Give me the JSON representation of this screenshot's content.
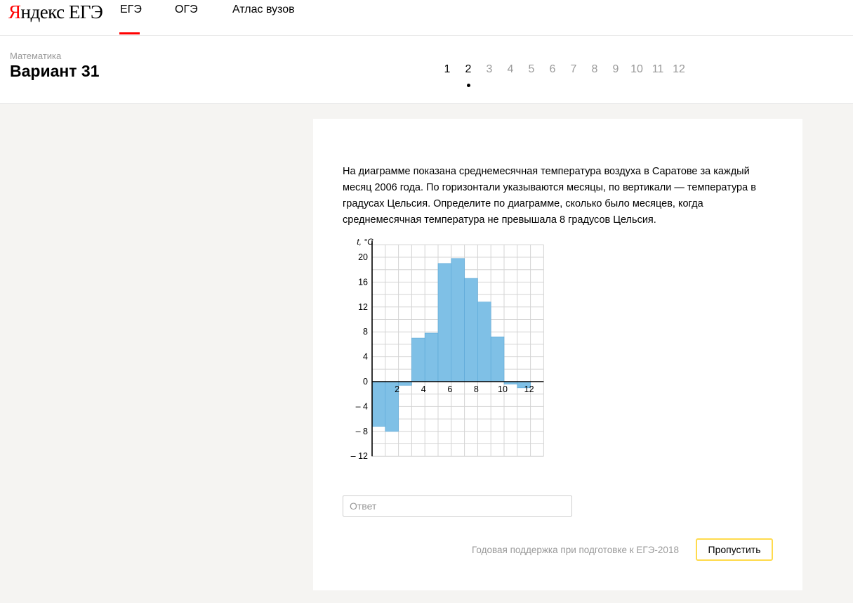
{
  "logo": {
    "part1": "Я",
    "part2": "ндекс ЕГЭ"
  },
  "nav": [
    {
      "label": "ЕГЭ",
      "active": true
    },
    {
      "label": "ОГЭ",
      "active": false
    },
    {
      "label": "Атлас вузов",
      "active": false
    }
  ],
  "header": {
    "subject": "Математика",
    "variant": "Вариант 31"
  },
  "pager": {
    "pages": [
      "1",
      "2",
      "3",
      "4",
      "5",
      "6",
      "7",
      "8",
      "9",
      "10",
      "11",
      "12"
    ],
    "current": "2"
  },
  "question": {
    "text": "На диаграмме показана среднемесячная температура воздуха в Саратове за каждый месяц 2006 года. По горизонтали указываются месяцы, по вертикали — температура в градусах Цельсия. Определите по диаграмме, сколько было месяцев, когда среднемесячная температура не превышала 8 градусов Цельсия."
  },
  "answer": {
    "placeholder": "Ответ"
  },
  "footer": {
    "support_link": "Годовая поддержка при подготовке к ЕГЭ-2018",
    "skip_label": "Пропустить"
  },
  "colors": {
    "accent": "#ff0000",
    "bar": "#7fc0e6",
    "skip_border": "#ffdb4d"
  },
  "chart_data": {
    "type": "bar",
    "ylabel": "t, °C",
    "categories": [
      1,
      2,
      3,
      4,
      5,
      6,
      7,
      8,
      9,
      10,
      11,
      12
    ],
    "values": [
      -7.2,
      -8,
      -0.6,
      7,
      7.8,
      19,
      19.8,
      16.6,
      12.8,
      7.2,
      -0.4,
      -1
    ],
    "xtick_labels": [
      "2",
      "4",
      "6",
      "8",
      "10",
      "12"
    ],
    "ytick_labels": [
      "20",
      "16",
      "12",
      "8",
      "4",
      "0",
      "– 4",
      "– 8",
      "– 12"
    ],
    "ylim": [
      -12,
      22
    ],
    "grid": true
  }
}
